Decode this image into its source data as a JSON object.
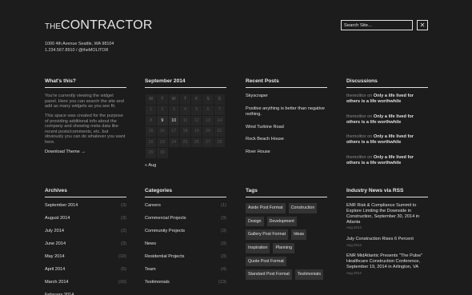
{
  "site": {
    "logo_prefix": "THE",
    "logo_main": "CONTRACTOR",
    "address": "1000 4th Avenue Seattle, WA 98104",
    "contact": "1.234.567.8910  /  @theMOLITOR"
  },
  "search": {
    "placeholder": "Search Site...",
    "close": "✕"
  },
  "whats_this": {
    "title": "What's this?",
    "p1": "You're currently viewing the widget panel. Here you can search the site and add as many widgets as you see fit.",
    "p2": "This space was created for the purpose of providing additional info about the company and showing meta data like recent posts/comments, etc. but obviously you can do whatever you want here.",
    "link": "Download Theme →"
  },
  "calendar": {
    "title": "September 2014",
    "weekdays": [
      "M",
      "T",
      "W",
      "T",
      "F",
      "S",
      "S"
    ],
    "rows": [
      [
        "1",
        "2",
        "3",
        "4",
        "5",
        "6",
        "7"
      ],
      [
        "8",
        "9",
        "10",
        "11",
        "12",
        "13",
        "14"
      ],
      [
        "15",
        "16",
        "17",
        "18",
        "19",
        "20",
        "21"
      ],
      [
        "22",
        "23",
        "24",
        "25",
        "26",
        "27",
        "28"
      ],
      [
        "29",
        "30",
        "",
        "",
        "",
        "",
        ""
      ]
    ],
    "active_days": [
      "9",
      "10"
    ],
    "prev": "« Aug"
  },
  "recent_posts": {
    "title": "Recent Posts",
    "items": [
      "Skyscraper",
      "Positive anything is better than negative nothing.",
      "Wind Turbine Road",
      "Rock Beach House",
      "River House"
    ]
  },
  "discussions": {
    "title": "Discussions",
    "items": [
      {
        "author": "themolitor",
        "on": "on",
        "post": "Only a life lived for others is a life worthwhile"
      },
      {
        "author": "themolitor",
        "on": "on",
        "post": "Only a life lived for others is a life worthwhile"
      },
      {
        "author": "themolitor",
        "on": "on",
        "post": "Only a life lived for others is a life worthwhile"
      },
      {
        "author": "themolitor",
        "on": "on",
        "post": "Only a life lived for others is a life worthwhile"
      }
    ]
  },
  "archives": {
    "title": "Archives",
    "items": [
      {
        "label": "September 2014",
        "count": "(3)"
      },
      {
        "label": "August 2014",
        "count": "(3)"
      },
      {
        "label": "July 2014",
        "count": "(3)"
      },
      {
        "label": "June 2014",
        "count": "(3)"
      },
      {
        "label": "May 2014",
        "count": "(10)"
      },
      {
        "label": "April 2014",
        "count": "(5)"
      },
      {
        "label": "March 2014",
        "count": "(16)"
      },
      {
        "label": "February 2014",
        "count": ""
      }
    ]
  },
  "categories": {
    "title": "Categories",
    "items": [
      {
        "label": "Careers",
        "count": "(1)"
      },
      {
        "label": "Commercial Projects",
        "count": "(3)"
      },
      {
        "label": "Community Projects",
        "count": "(3)"
      },
      {
        "label": "News",
        "count": "(3)"
      },
      {
        "label": "Residential Projects",
        "count": "(3)"
      },
      {
        "label": "Team",
        "count": "(4)"
      },
      {
        "label": "Testimonials",
        "count": "(13)"
      }
    ]
  },
  "tags": {
    "title": "Tags",
    "items": [
      "Aside Post Format",
      "Construction",
      "Design",
      "Development",
      "Gallery Post Format",
      "Ideas",
      "Inspiration",
      "Planning",
      "Quote Post Format",
      "Standard Post Format",
      "Testimonials"
    ]
  },
  "industry_news": {
    "title": "Industry News via RSS",
    "items": [
      {
        "title": "ENR Risk & Compliance Summit to Explore Limiting the Downside in Construction, September 30, 2014 in Atlanta",
        "date": "Aug 2014"
      },
      {
        "title": "July Construction Rises 6 Percent",
        "date": "Aug 2014"
      },
      {
        "title": "ENR MidAtlantic Presents \"The Pulse\" Healthcare Construction Conference, September 19, 2014 in Arlington, VA",
        "date": "Aug 2014"
      }
    ]
  }
}
